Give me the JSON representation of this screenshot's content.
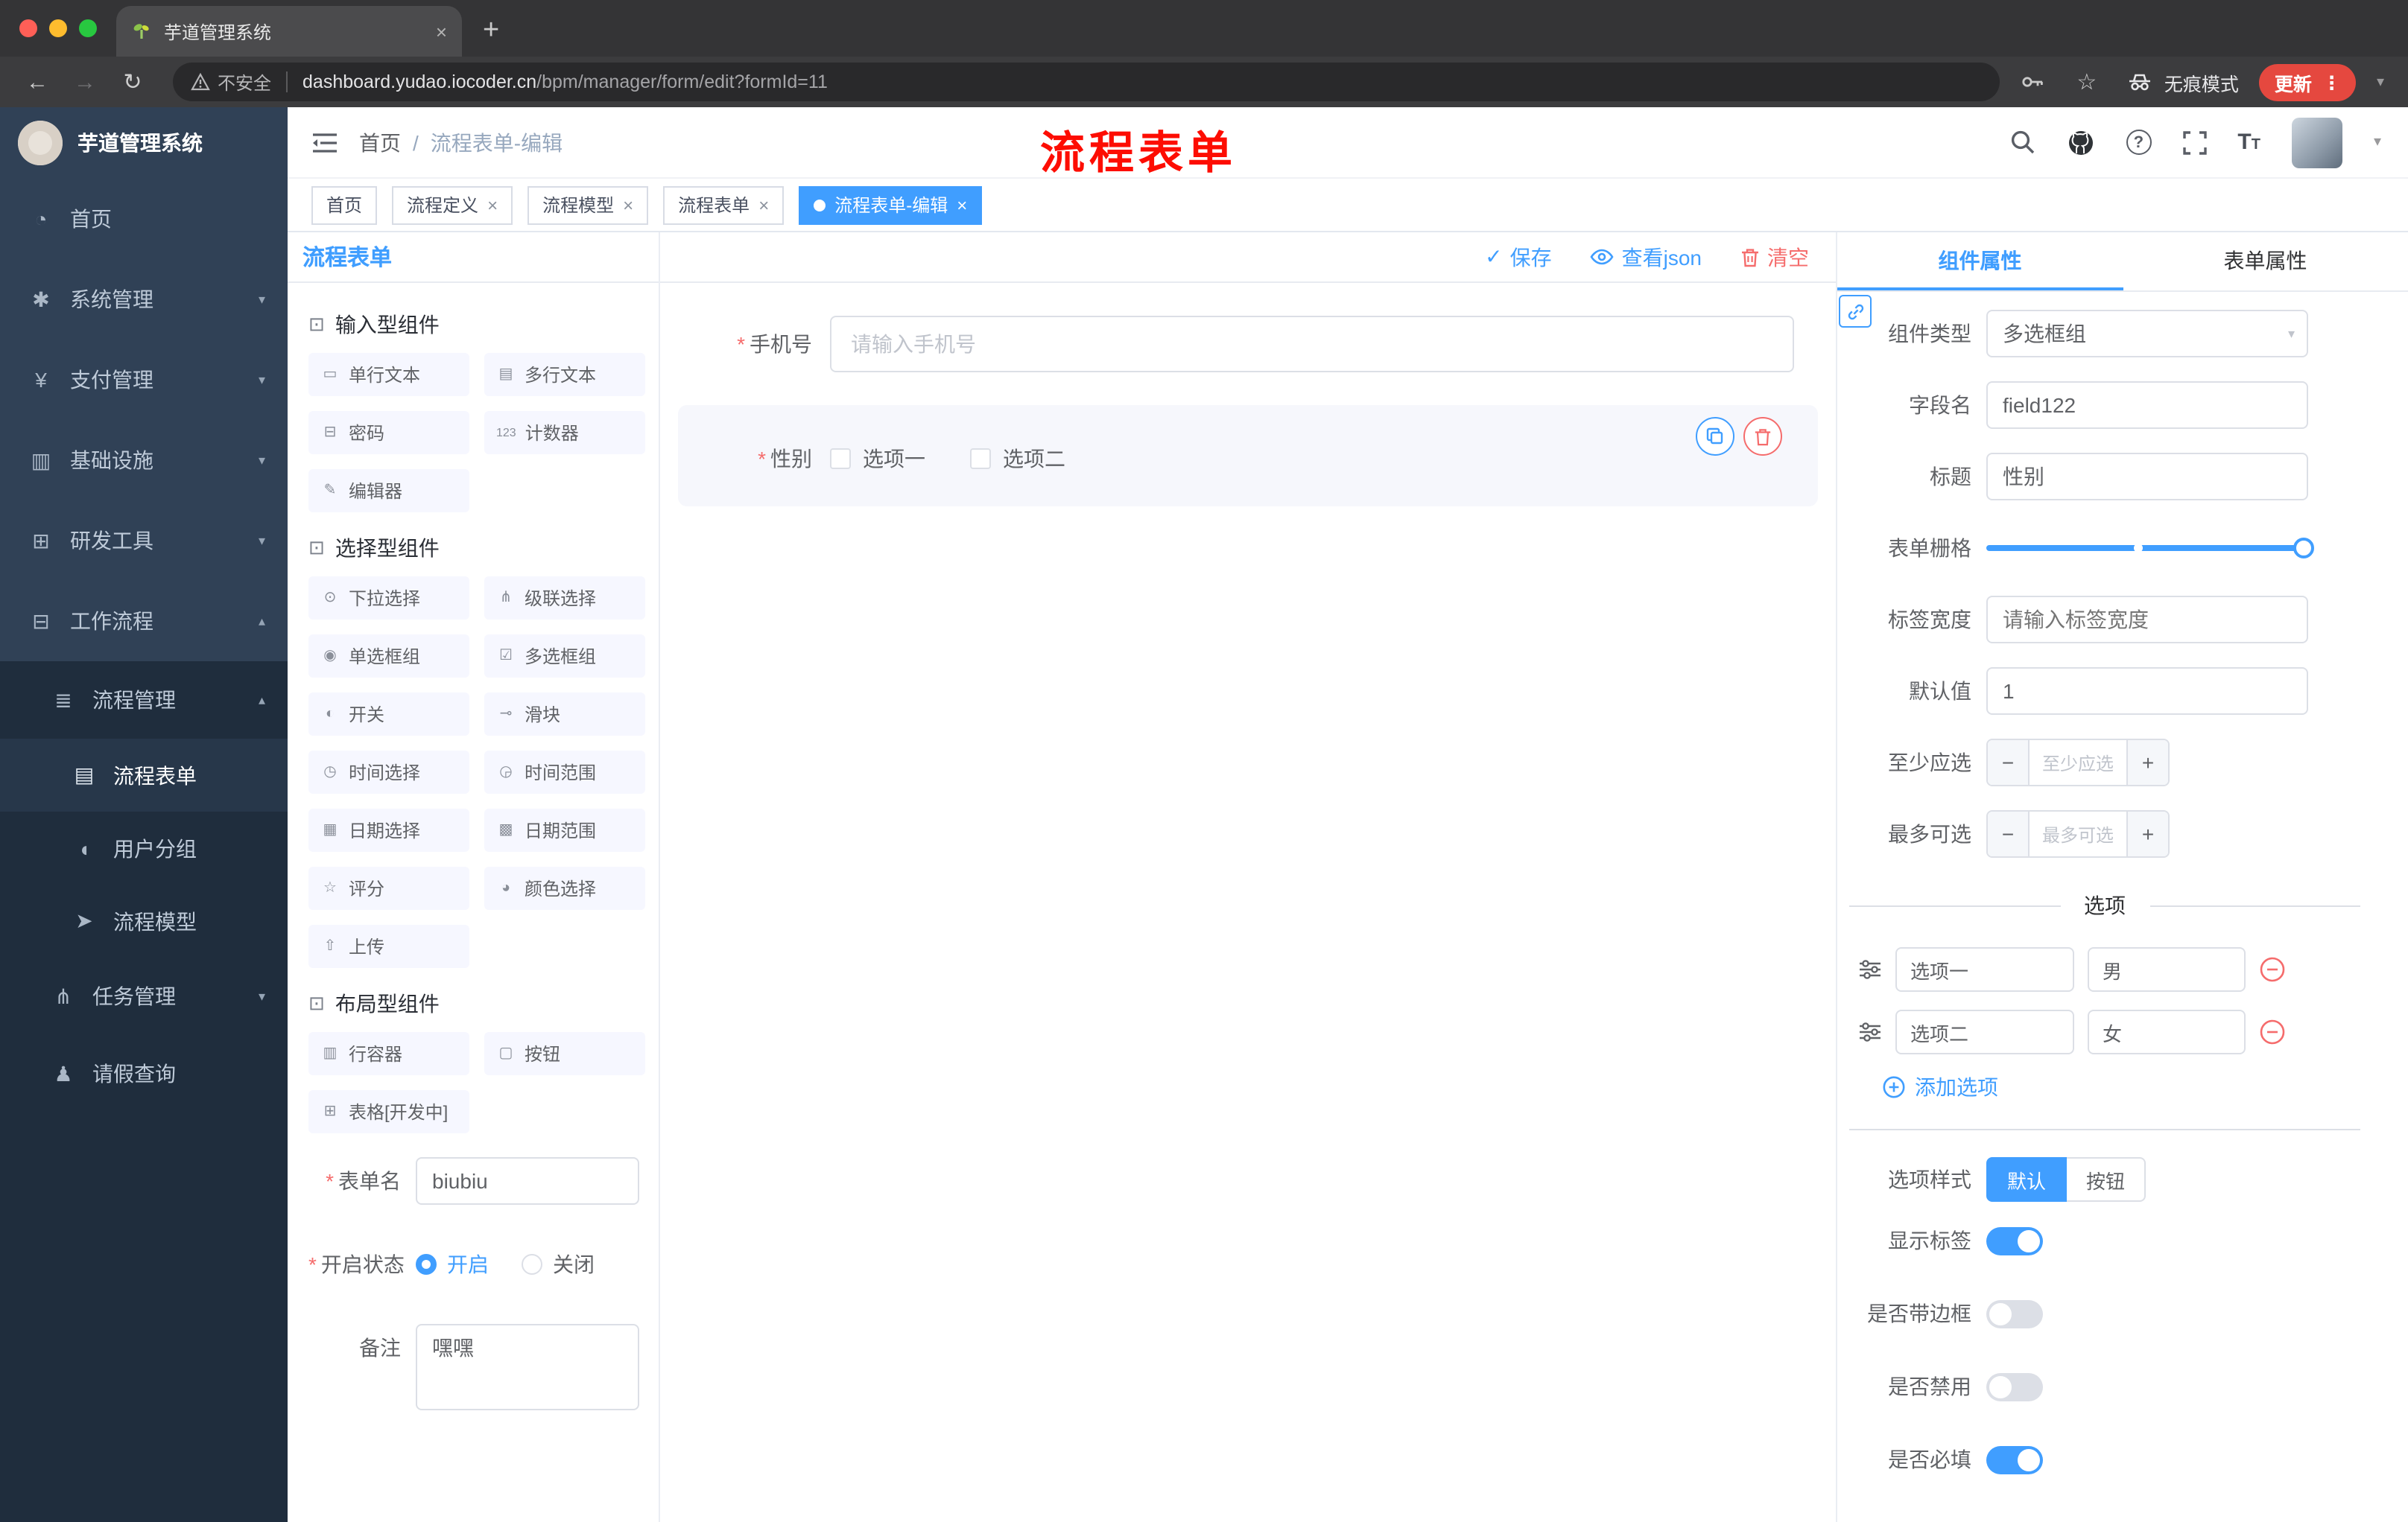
{
  "colors": {
    "accent": "#409eff",
    "danger": "#f56c6c",
    "sidebar": "#304156",
    "annotation_red": "#fd0d02"
  },
  "icons": {
    "back": "←",
    "forward": "→",
    "reload": "↻",
    "star": "☆",
    "dots": "⋮",
    "chev_down": "▾",
    "chev_up": "▴",
    "plus": "+",
    "close": "×",
    "minus": "−",
    "check": "✓"
  },
  "browser": {
    "tab_title": "芋道管理系统",
    "security": "不安全",
    "url_domain": "dashboard.yudao.iocoder.cn",
    "url_path": "/bpm/manager/form/edit?formId=11",
    "incognito": "无痕模式",
    "update": "更新"
  },
  "sidebar": {
    "app_title": "芋道管理系统",
    "menu": [
      {
        "label": "首页",
        "glyph": "◔"
      },
      {
        "label": "系统管理",
        "glyph": "✱",
        "chevron": "▾"
      },
      {
        "label": "支付管理",
        "glyph": "¥",
        "chevron": "▾"
      },
      {
        "label": "基础设施",
        "glyph": "▥",
        "chevron": "▾"
      },
      {
        "label": "研发工具",
        "glyph": "⊞",
        "chevron": "▾"
      },
      {
        "label": "工作流程",
        "glyph": "⊟",
        "chevron": "▴"
      }
    ],
    "submenu": [
      {
        "label": "流程管理",
        "glyph": "≣",
        "chevron": "▴"
      },
      {
        "label": "流程表单",
        "glyph": "▤"
      },
      {
        "label": "用户分组",
        "glyph": "◖"
      },
      {
        "label": "流程模型",
        "glyph": "➤"
      },
      {
        "label": "任务管理",
        "glyph": "⋔",
        "chevron": "▾"
      },
      {
        "label": "请假查询",
        "glyph": "♟"
      }
    ]
  },
  "header": {
    "breadcrumb_home": "首页",
    "breadcrumb_sep": "/",
    "breadcrumb_current": "流程表单-编辑",
    "annotation": "流程表单"
  },
  "tags": {
    "items": [
      {
        "label": "首页"
      },
      {
        "label": "流程定义"
      },
      {
        "label": "流程模型"
      },
      {
        "label": "流程表单"
      },
      {
        "label": "流程表单-编辑",
        "active": true
      }
    ]
  },
  "palette": {
    "title": "流程表单",
    "sections": [
      {
        "title": "输入型组件",
        "glyph": "⊡",
        "items": [
          {
            "label": "单行文本",
            "glyph": "▭"
          },
          {
            "label": "多行文本",
            "glyph": "▤"
          },
          {
            "label": "密码",
            "glyph": "⊟"
          },
          {
            "label": "计数器",
            "glyph": "123"
          },
          {
            "label": "编辑器",
            "glyph": "✎"
          }
        ]
      },
      {
        "title": "选择型组件",
        "glyph": "⊡",
        "items": [
          {
            "label": "下拉选择",
            "glyph": "⊙"
          },
          {
            "label": "级联选择",
            "glyph": "⋔"
          },
          {
            "label": "单选框组",
            "glyph": "◉"
          },
          {
            "label": "多选框组",
            "glyph": "☑"
          },
          {
            "label": "开关",
            "glyph": "◐"
          },
          {
            "label": "滑块",
            "glyph": "⊸"
          },
          {
            "label": "时间选择",
            "glyph": "◷"
          },
          {
            "label": "时间范围",
            "glyph": "◶"
          },
          {
            "label": "日期选择",
            "glyph": "▦"
          },
          {
            "label": "日期范围",
            "glyph": "▩"
          },
          {
            "label": "评分",
            "glyph": "☆"
          },
          {
            "label": "颜色选择",
            "glyph": "◕"
          },
          {
            "label": "上传",
            "glyph": "⇧"
          }
        ]
      },
      {
        "title": "布局型组件",
        "glyph": "⊡",
        "items": [
          {
            "label": "行容器",
            "glyph": "▥"
          },
          {
            "label": "按钮",
            "glyph": "▢"
          },
          {
            "label": "表格[开发中]",
            "glyph": "⊞"
          }
        ]
      }
    ],
    "form": {
      "required_mark": "*",
      "name_label": "表单名",
      "name_value": "biubiu",
      "status_label": "开启状态",
      "status_on": "开启",
      "status_off": "关闭",
      "remark_label": "备注",
      "remark_value": "嘿嘿"
    }
  },
  "canvas": {
    "toolbar": {
      "save": "保存",
      "view_json": "查看json",
      "clear": "清空"
    },
    "field_phone": {
      "label": "手机号",
      "placeholder": "请输入手机号"
    },
    "field_gender": {
      "label": "性别",
      "opt1": "选项一",
      "opt2": "选项二"
    }
  },
  "props": {
    "tab_component": "组件属性",
    "tab_form": "表单属性",
    "type_label": "组件类型",
    "type_value": "多选框组",
    "field_label": "字段名",
    "field_value": "field122",
    "title_label": "标题",
    "title_value": "性别",
    "grid_label": "表单栅格",
    "label_width_label": "标签宽度",
    "label_width_placeholder": "请输入标签宽度",
    "default_label": "默认值",
    "default_value": "1",
    "min_label": "至少应选",
    "min_placeholder": "至少应选",
    "max_label": "最多可选",
    "max_placeholder": "最多可选",
    "options_divider": "选项",
    "option_rows": [
      {
        "name": "选项一",
        "value": "男"
      },
      {
        "name": "选项二",
        "value": "女"
      }
    ],
    "add_option": "添加选项",
    "style_label": "选项样式",
    "style_default": "默认",
    "style_button": "按钮",
    "switch_show_label": "显示标签",
    "switch_border": "是否带边框",
    "switch_disabled": "是否禁用",
    "switch_required": "是否必填"
  }
}
